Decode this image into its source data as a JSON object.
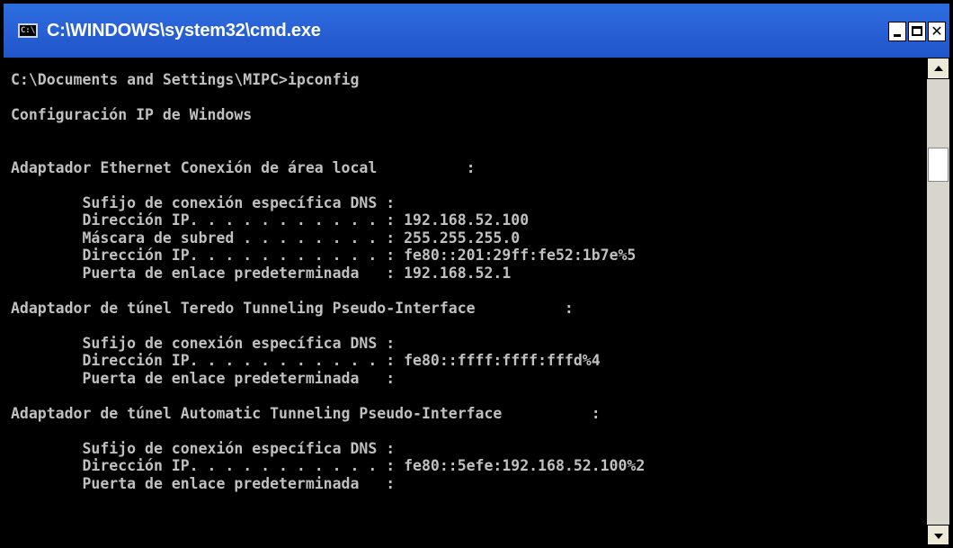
{
  "window": {
    "title": "C:\\WINDOWS\\system32\\cmd.exe",
    "icon_label": "C:\\"
  },
  "console": {
    "text": "C:\\Documents and Settings\\MIPC>ipconfig\n\nConfiguración IP de Windows\n\n\nAdaptador Ethernet Conexión de área local          :\n\n        Sufijo de conexión específica DNS :\n        Dirección IP. . . . . . . . . . . : 192.168.52.100\n        Máscara de subred . . . . . . . . : 255.255.255.0\n        Dirección IP. . . . . . . . . . . : fe80::201:29ff:fe52:1b7e%5\n        Puerta de enlace predeterminada   : 192.168.52.1\n\nAdaptador de túnel Teredo Tunneling Pseudo-Interface          :\n\n        Sufijo de conexión específica DNS :\n        Dirección IP. . . . . . . . . . . : fe80::ffff:ffff:fffd%4\n        Puerta de enlace predeterminada   :\n\nAdaptador de túnel Automatic Tunneling Pseudo-Interface          :\n\n        Sufijo de conexión específica DNS :\n        Dirección IP. . . . . . . . . . . : fe80::5efe:192.168.52.100%2\n        Puerta de enlace predeterminada   :"
  },
  "controls": {
    "minimize": "minimize-icon",
    "maximize": "maximize-icon",
    "close": "close-icon",
    "close_glyph": "✕"
  },
  "scrollbar": {
    "up": "scroll-up-arrow-icon",
    "down": "scroll-down-arrow-icon"
  }
}
